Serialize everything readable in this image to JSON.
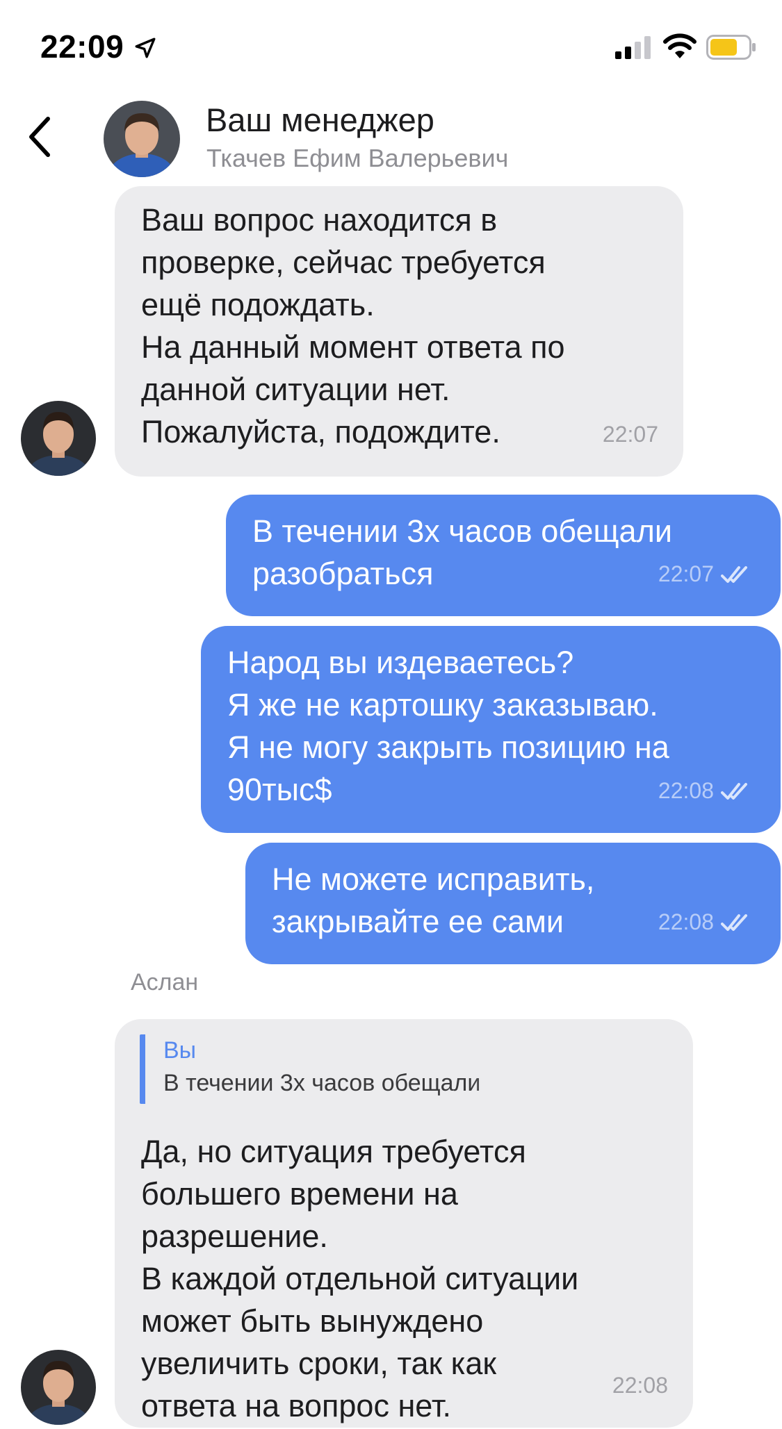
{
  "status_bar": {
    "time": "22:09",
    "icons": [
      "location-arrow-icon",
      "cellular-signal-icon",
      "wifi-icon",
      "battery-icon"
    ],
    "battery_color": "#f5c518"
  },
  "header": {
    "title": "Ваш менеджер",
    "subtitle": "Ткачев Ефим Валерьевич"
  },
  "colors": {
    "outgoing_bubble": "#5789ef",
    "incoming_bubble": "#ececee",
    "accent": "#5789ef"
  },
  "messages": [
    {
      "direction": "in",
      "text": "Ваш вопрос находится в\nпроверке, сейчас требуется\nещё подождать.\nНа данный момент ответа по\nданной ситуации нет.\nПожалуйста, подождите.",
      "time": "22:07"
    },
    {
      "direction": "out",
      "text": "В течении 3х часов обещали\nразобраться",
      "time": "22:07",
      "status": "read"
    },
    {
      "direction": "out",
      "text": "Народ вы издеваетесь?\nЯ же не картошку заказываю.\nЯ не могу закрыть позицию на\n90тыс$",
      "time": "22:08",
      "status": "read"
    },
    {
      "direction": "out",
      "text": "Не можете исправить,\nзакрывайте ее сами",
      "time": "22:08",
      "status": "read"
    },
    {
      "direction": "in",
      "sender": "Аслан",
      "reply": {
        "author": "Вы",
        "text": "В течении 3х часов обещали"
      },
      "text": "Да, но ситуация требуется\nбольшего времени на\nразрешение.\nВ каждой отдельной ситуации\nможет быть вынуждено\nувеличить сроки, так как\nответа на вопрос нет.",
      "time": "22:08"
    }
  ]
}
